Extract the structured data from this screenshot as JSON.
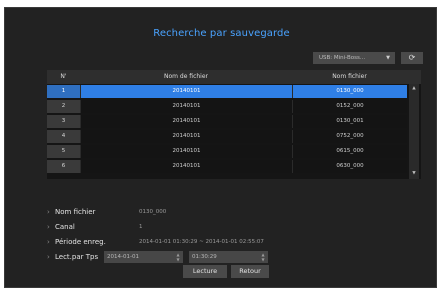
{
  "dialog": {
    "title": "Recherche par sauvegarde",
    "device_select": "USB: Mini-Boss...",
    "refresh_icon": "refresh-icon"
  },
  "table": {
    "headers": [
      "N'",
      "Nom de fichier",
      "Nom fichier"
    ],
    "rows": [
      {
        "num": "1",
        "file": "20140101",
        "name": "0130_000",
        "selected": true
      },
      {
        "num": "2",
        "file": "20140101",
        "name": "0152_000",
        "selected": false
      },
      {
        "num": "3",
        "file": "20140101",
        "name": "0130_001",
        "selected": false
      },
      {
        "num": "4",
        "file": "20140101",
        "name": "0752_000",
        "selected": false
      },
      {
        "num": "5",
        "file": "20140101",
        "name": "0615_000",
        "selected": false
      },
      {
        "num": "6",
        "file": "20140101",
        "name": "0630_000",
        "selected": false
      }
    ]
  },
  "details": {
    "file_label": "Nom fichier",
    "file_value": "0130_000",
    "channel_label": "Canal",
    "channel_value": "1",
    "period_label": "Période enreg.",
    "period_value": "2014-01-01 01:30:29 ~ 2014-01-01 02:55:07",
    "play_time_label": "Lect.par Tps",
    "play_date": "2014-01-01",
    "play_time": "01:30:29"
  },
  "buttons": {
    "play": "Lecture",
    "back": "Retour"
  },
  "colors": {
    "title": "#4aa3ff",
    "selection": "#2f7fe6",
    "background": "#222222"
  }
}
